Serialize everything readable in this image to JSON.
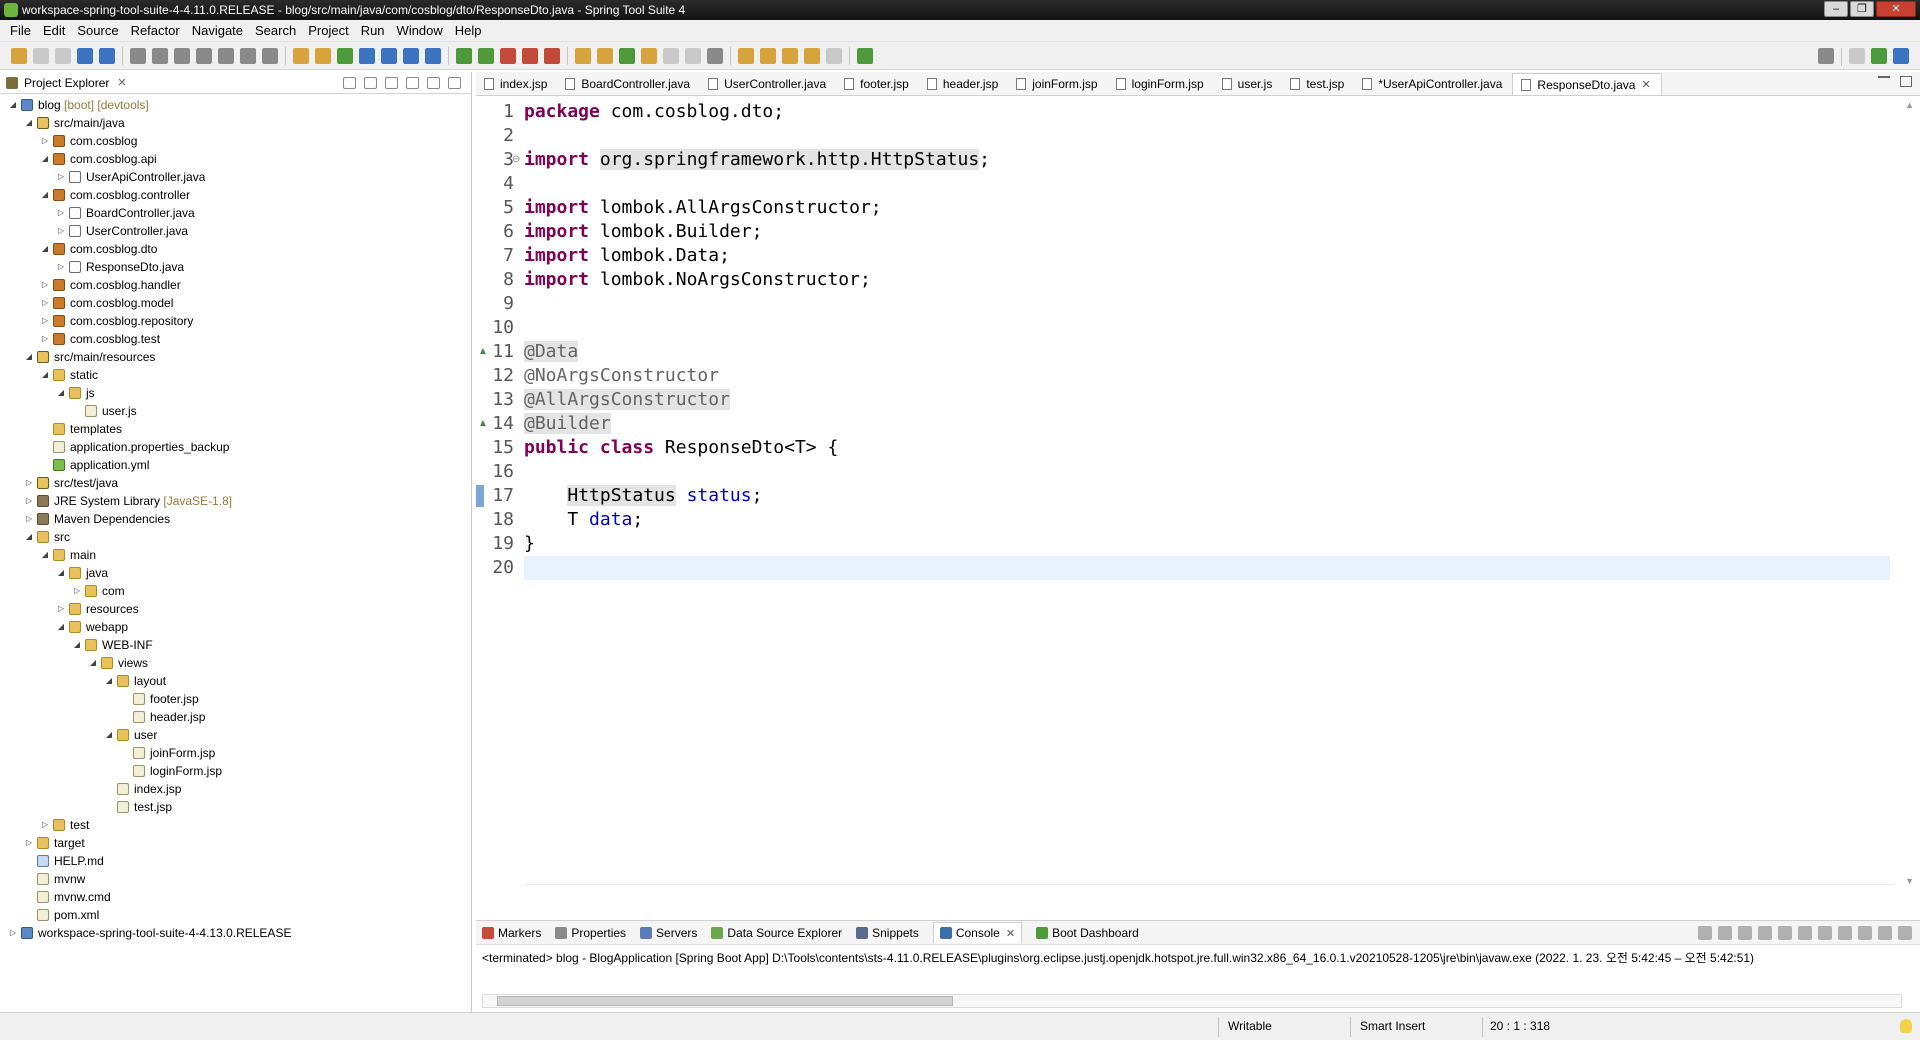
{
  "window": {
    "title": "workspace-spring-tool-suite-4-4.11.0.RELEASE - blog/src/main/java/com/cosblog/dto/ResponseDto.java - Spring Tool Suite 4"
  },
  "menu": [
    "File",
    "Edit",
    "Source",
    "Refactor",
    "Navigate",
    "Search",
    "Project",
    "Run",
    "Window",
    "Help"
  ],
  "project_explorer": {
    "title": "Project Explorer",
    "close": "✕",
    "tree": [
      {
        "label": "blog",
        "decoration": "[boot] [devtools]",
        "icon": "project-icon",
        "twisty": "◢",
        "depth": 0
      },
      {
        "label": "src/main/java",
        "icon": "source-folder-icon",
        "twisty": "◢",
        "depth": 1
      },
      {
        "label": "com.cosblog",
        "icon": "package-icon",
        "twisty": "▷",
        "depth": 2
      },
      {
        "label": "com.cosblog.api",
        "icon": "package-icon",
        "twisty": "◢",
        "depth": 2
      },
      {
        "label": "UserApiController.java",
        "icon": "java-file-icon",
        "twisty": "▷",
        "depth": 3
      },
      {
        "label": "com.cosblog.controller",
        "icon": "package-icon",
        "twisty": "◢",
        "depth": 2
      },
      {
        "label": "BoardController.java",
        "icon": "java-file-icon",
        "twisty": "▷",
        "depth": 3
      },
      {
        "label": "UserController.java",
        "icon": "java-file-icon",
        "twisty": "▷",
        "depth": 3
      },
      {
        "label": "com.cosblog.dto",
        "icon": "package-icon",
        "twisty": "◢",
        "depth": 2
      },
      {
        "label": "ResponseDto.java",
        "icon": "java-file-icon",
        "twisty": "▷",
        "depth": 3
      },
      {
        "label": "com.cosblog.handler",
        "icon": "package-icon",
        "twisty": "▷",
        "depth": 2
      },
      {
        "label": "com.cosblog.model",
        "icon": "package-icon",
        "twisty": "▷",
        "depth": 2
      },
      {
        "label": "com.cosblog.repository",
        "icon": "package-icon",
        "twisty": "▷",
        "depth": 2
      },
      {
        "label": "com.cosblog.test",
        "icon": "package-icon",
        "twisty": "▷",
        "depth": 2
      },
      {
        "label": "src/main/resources",
        "icon": "source-folder-icon",
        "twisty": "◢",
        "depth": 1
      },
      {
        "label": "static",
        "icon": "folder-icon",
        "twisty": "◢",
        "depth": 2
      },
      {
        "label": "js",
        "icon": "folder-icon",
        "twisty": "◢",
        "depth": 3
      },
      {
        "label": "user.js",
        "icon": "file-icon",
        "twisty": "",
        "depth": 4
      },
      {
        "label": "templates",
        "icon": "folder-icon",
        "twisty": "",
        "depth": 2
      },
      {
        "label": "application.properties_backup",
        "icon": "file-icon",
        "twisty": "",
        "depth": 2
      },
      {
        "label": "application.yml",
        "icon": "yml-file-icon",
        "twisty": "",
        "depth": 2
      },
      {
        "label": "src/test/java",
        "icon": "source-folder-icon",
        "twisty": "▷",
        "depth": 1
      },
      {
        "label": "JRE System Library",
        "decoration": "[JavaSE-1.8]",
        "icon": "library-icon",
        "twisty": "▷",
        "depth": 1
      },
      {
        "label": "Maven Dependencies",
        "icon": "library-icon",
        "twisty": "▷",
        "depth": 1
      },
      {
        "label": "src",
        "icon": "folder-icon",
        "twisty": "◢",
        "depth": 1
      },
      {
        "label": "main",
        "icon": "folder-icon",
        "twisty": "◢",
        "depth": 2
      },
      {
        "label": "java",
        "icon": "folder-icon",
        "twisty": "◢",
        "depth": 3
      },
      {
        "label": "com",
        "icon": "folder-icon",
        "twisty": "▷",
        "depth": 4
      },
      {
        "label": "resources",
        "icon": "folder-icon",
        "twisty": "▷",
        "depth": 3
      },
      {
        "label": "webapp",
        "icon": "folder-icon",
        "twisty": "◢",
        "depth": 3
      },
      {
        "label": "WEB-INF",
        "icon": "folder-icon",
        "twisty": "◢",
        "depth": 4
      },
      {
        "label": "views",
        "icon": "folder-icon",
        "twisty": "◢",
        "depth": 5
      },
      {
        "label": "layout",
        "icon": "folder-icon",
        "twisty": "◢",
        "depth": 6
      },
      {
        "label": "footer.jsp",
        "icon": "file-icon",
        "twisty": "",
        "depth": 7
      },
      {
        "label": "header.jsp",
        "icon": "file-icon",
        "twisty": "",
        "depth": 7
      },
      {
        "label": "user",
        "icon": "folder-icon",
        "twisty": "◢",
        "depth": 6
      },
      {
        "label": "joinForm.jsp",
        "icon": "file-icon",
        "twisty": "",
        "depth": 7
      },
      {
        "label": "loginForm.jsp",
        "icon": "file-icon",
        "twisty": "",
        "depth": 7
      },
      {
        "label": "index.jsp",
        "icon": "file-icon",
        "twisty": "",
        "depth": 6
      },
      {
        "label": "test.jsp",
        "icon": "file-icon",
        "twisty": "",
        "depth": 6
      },
      {
        "label": "test",
        "icon": "folder-icon",
        "twisty": "▷",
        "depth": 2
      },
      {
        "label": "target",
        "icon": "folder-icon",
        "twisty": "▷",
        "depth": 1
      },
      {
        "label": "HELP.md",
        "icon": "md-file-icon",
        "twisty": "",
        "depth": 1
      },
      {
        "label": "mvnw",
        "icon": "file-icon",
        "twisty": "",
        "depth": 1
      },
      {
        "label": "mvnw.cmd",
        "icon": "file-icon",
        "twisty": "",
        "depth": 1
      },
      {
        "label": "pom.xml",
        "icon": "file-icon",
        "twisty": "",
        "depth": 1
      },
      {
        "label": "workspace-spring-tool-suite-4-4.13.0.RELEASE",
        "icon": "project-icon",
        "twisty": "▷",
        "depth": 0
      }
    ]
  },
  "editor_tabs": [
    {
      "label": "index.jsp",
      "active": false
    },
    {
      "label": "BoardController.java",
      "active": false
    },
    {
      "label": "UserController.java",
      "active": false
    },
    {
      "label": "footer.jsp",
      "active": false
    },
    {
      "label": "header.jsp",
      "active": false
    },
    {
      "label": "joinForm.jsp",
      "active": false
    },
    {
      "label": "loginForm.jsp",
      "active": false
    },
    {
      "label": "user.js",
      "active": false
    },
    {
      "label": "test.jsp",
      "active": false
    },
    {
      "label": "*UserApiController.java",
      "active": false
    },
    {
      "label": "ResponseDto.java",
      "active": true,
      "close": "✕"
    }
  ],
  "editor": {
    "lines": [
      {
        "n": "1",
        "parts": [
          [
            "kw",
            "package"
          ],
          [
            "t",
            " com.cosblog.dto;"
          ]
        ]
      },
      {
        "n": "2",
        "parts": []
      },
      {
        "n": "3",
        "parts": [
          [
            "kw",
            "import"
          ],
          [
            "t",
            " "
          ],
          [
            "hl",
            "org.springframework.http.HttpStatus"
          ],
          [
            "t",
            ";"
          ]
        ]
      },
      {
        "n": "4",
        "parts": []
      },
      {
        "n": "5",
        "parts": [
          [
            "kw",
            "import"
          ],
          [
            "t",
            " lombok.AllArgsConstructor;"
          ]
        ]
      },
      {
        "n": "6",
        "parts": [
          [
            "kw",
            "import"
          ],
          [
            "t",
            " lombok.Builder;"
          ]
        ]
      },
      {
        "n": "7",
        "parts": [
          [
            "kw",
            "import"
          ],
          [
            "t",
            " lombok.Data;"
          ]
        ]
      },
      {
        "n": "8",
        "parts": [
          [
            "kw",
            "import"
          ],
          [
            "t",
            " lombok.NoArgsConstructor;"
          ]
        ]
      },
      {
        "n": "9",
        "parts": []
      },
      {
        "n": "10",
        "parts": []
      },
      {
        "n": "11",
        "parts": [
          [
            "annhl",
            "@Data"
          ]
        ]
      },
      {
        "n": "12",
        "parts": [
          [
            "ann",
            "@NoArgsConstructor"
          ]
        ]
      },
      {
        "n": "13",
        "parts": [
          [
            "annhl",
            "@AllArgsConstructor"
          ]
        ]
      },
      {
        "n": "14",
        "parts": [
          [
            "annhl",
            "@Builder"
          ]
        ]
      },
      {
        "n": "15",
        "parts": [
          [
            "kw",
            "public"
          ],
          [
            "t",
            " "
          ],
          [
            "kw",
            "class"
          ],
          [
            "t",
            " ResponseDto<T> {"
          ]
        ]
      },
      {
        "n": "16",
        "parts": []
      },
      {
        "n": "17",
        "parts": [
          [
            "t",
            "    "
          ],
          [
            "hl",
            "HttpStatus"
          ],
          [
            "t",
            " "
          ],
          [
            "fld",
            "status"
          ],
          [
            "t",
            ";"
          ]
        ]
      },
      {
        "n": "18",
        "parts": [
          [
            "t",
            "    T "
          ],
          [
            "fld",
            "data"
          ],
          [
            "t",
            ";"
          ]
        ]
      },
      {
        "n": "19",
        "parts": [
          [
            "t",
            "}"
          ]
        ]
      },
      {
        "n": "20",
        "parts": []
      }
    ],
    "fold_marker": "⊖"
  },
  "bottom_tabs": [
    {
      "label": "Markers",
      "icon": "markers-icon"
    },
    {
      "label": "Properties",
      "icon": "properties-icon"
    },
    {
      "label": "Servers",
      "icon": "servers-icon"
    },
    {
      "label": "Data Source Explorer",
      "icon": "data-source-icon"
    },
    {
      "label": "Snippets",
      "icon": "snippets-icon"
    },
    {
      "label": "Console",
      "icon": "console-icon",
      "active": true,
      "close": "✕"
    },
    {
      "label": "Boot Dashboard",
      "icon": "boot-dashboard-icon"
    }
  ],
  "console": {
    "text": "<terminated> blog - BlogApplication [Spring Boot App] D:\\Tools\\contents\\sts-4.11.0.RELEASE\\plugins\\org.eclipse.justj.openjdk.hotspot.jre.full.win32.x86_64_16.0.1.v20210528-1205\\jre\\bin\\javaw.exe  (2022. 1. 23. 오전 5:42:45 – 오전 5:42:51)"
  },
  "status": {
    "writable": "Writable",
    "insert_mode": "Smart Insert",
    "position": "20 : 1 : 318"
  }
}
